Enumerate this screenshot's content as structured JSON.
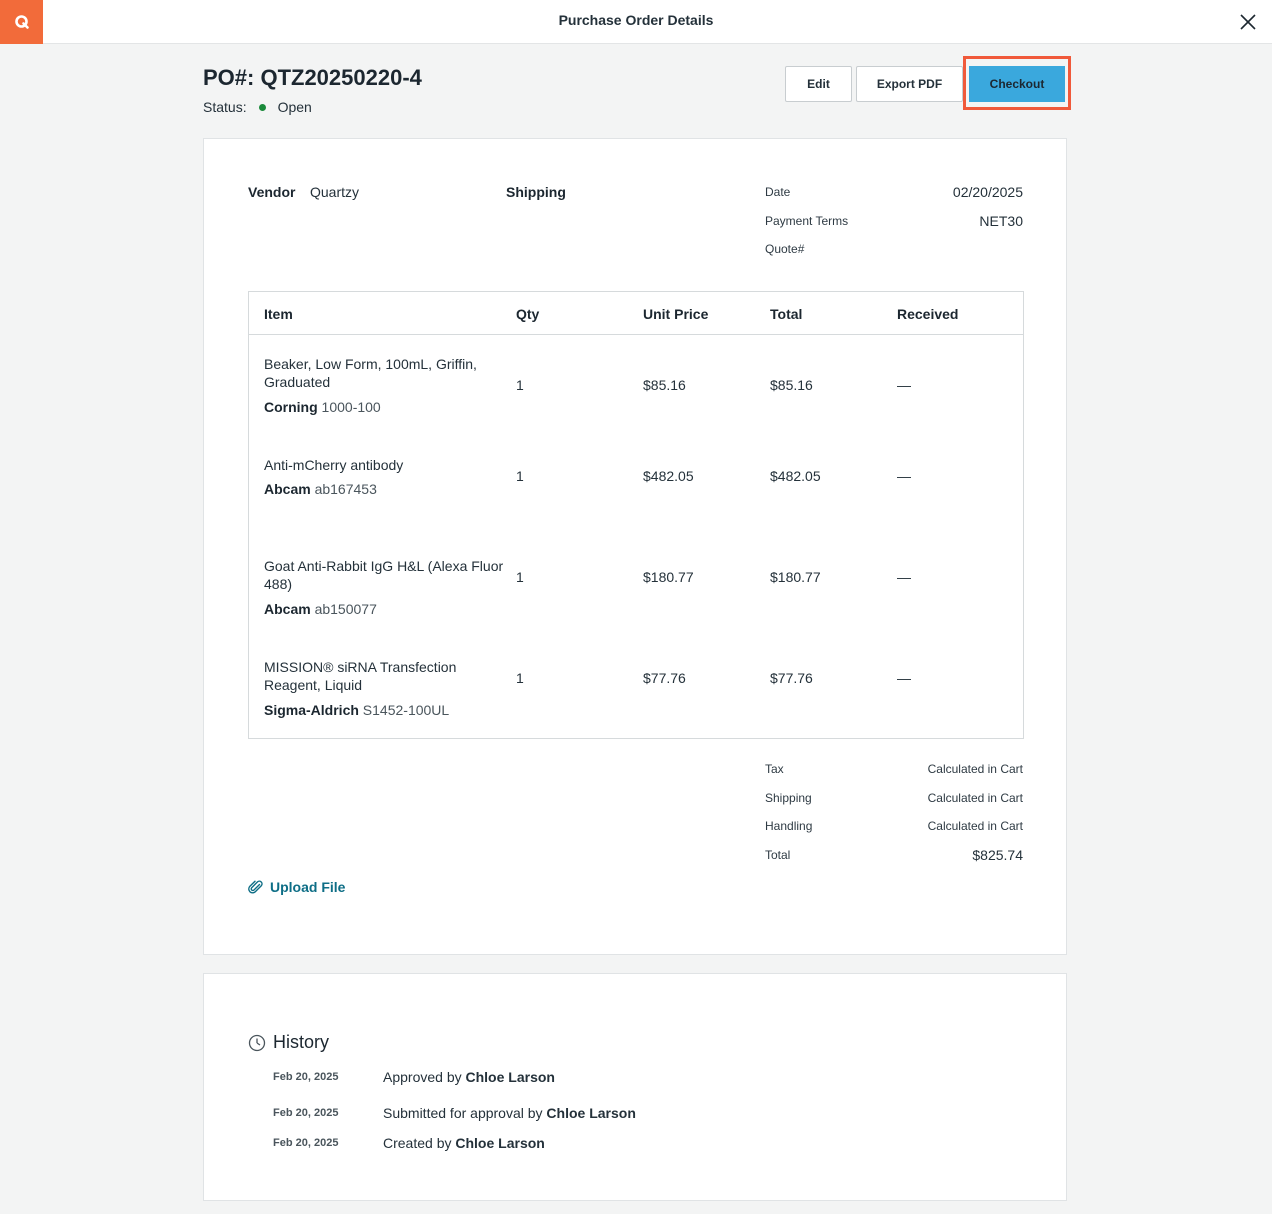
{
  "header": {
    "title": "Purchase Order Details",
    "logo_letter": "Q",
    "brand_color": "#f26b3a"
  },
  "po": {
    "title": "PO#: QTZ20250220-4",
    "status_label": "Status:",
    "status_value": "Open",
    "status_color": "#1a8a3a"
  },
  "actions": {
    "edit": "Edit",
    "export": "Export PDF",
    "checkout": "Checkout",
    "checkout_color": "#3aa8dd",
    "highlight_color": "#f0593a"
  },
  "details": {
    "vendor_label": "Vendor",
    "vendor_value": "Quartzy",
    "shipping_label": "Shipping",
    "date_label": "Date",
    "date_value": "02/20/2025",
    "terms_label": "Payment Terms",
    "terms_value": "NET30",
    "quote_label": "Quote#"
  },
  "table": {
    "headers": [
      "Item",
      "Qty",
      "Unit Price",
      "Total",
      "Received"
    ],
    "rows": [
      {
        "name": "Beaker, Low Form, 100mL, Griffin, Graduated",
        "brand": "Corning",
        "sku": "1000-100",
        "qty": "1",
        "unit_price": "$85.16",
        "total": "$85.16",
        "received": "—"
      },
      {
        "name": "Anti-mCherry antibody",
        "brand": "Abcam",
        "sku": "ab167453",
        "qty": "1",
        "unit_price": "$482.05",
        "total": "$482.05",
        "received": "—"
      },
      {
        "name": "Goat Anti-Rabbit IgG H&L (Alexa Fluor 488)",
        "brand": "Abcam",
        "sku": "ab150077",
        "qty": "1",
        "unit_price": "$180.77",
        "total": "$180.77",
        "received": "—"
      },
      {
        "name": "MISSION® siRNA Transfection Reagent, Liquid",
        "brand": "Sigma-Aldrich",
        "sku": "S1452-100UL",
        "qty": "1",
        "unit_price": "$77.76",
        "total": "$77.76",
        "received": "—"
      }
    ]
  },
  "summary": {
    "tax_label": "Tax",
    "tax_value": "Calculated in Cart",
    "shipping_label": "Shipping",
    "shipping_value": "Calculated in Cart",
    "handling_label": "Handling",
    "handling_value": "Calculated in Cart",
    "total_label": "Total",
    "total_value": "$825.74"
  },
  "upload": {
    "label": "Upload File",
    "icon": "paperclip-icon"
  },
  "history": {
    "title": "History",
    "icon": "clock-icon",
    "entries": [
      {
        "date": "Feb 20, 2025",
        "text": "Approved by",
        "user": "Chloe Larson"
      },
      {
        "date": "Feb 20, 2025",
        "text": "Submitted for approval by",
        "user": "Chloe Larson"
      },
      {
        "date": "Feb 20, 2025",
        "text": "Created by",
        "user": "Chloe Larson"
      }
    ]
  }
}
